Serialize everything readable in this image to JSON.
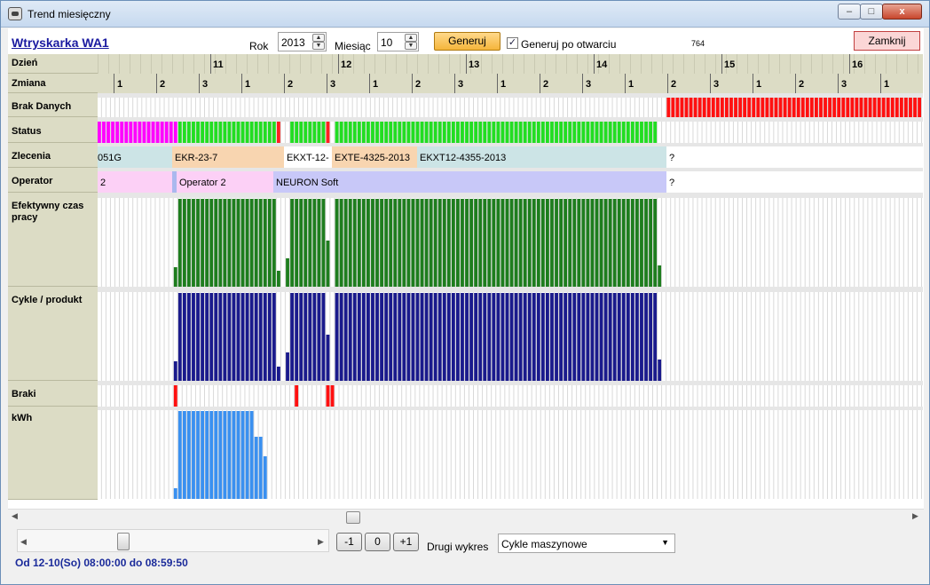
{
  "window": {
    "title": "Trend miesięczny",
    "min_label": "–",
    "max_label": "□",
    "close_label": "x"
  },
  "header": {
    "machine_title": "Wtryskarka WA1",
    "year_label": "Rok",
    "year_value": "2013",
    "month_label": "Miesiąc",
    "month_value": "10",
    "generate_label": "Generuj",
    "generate_on_open_label": "Generuj po otwarciu",
    "generate_on_open_checked": true,
    "code": "764",
    "close_label": "Zamknij"
  },
  "rows": {
    "day": "Dzień",
    "shift": "Zmiana",
    "no_data": "Brak Danych",
    "status": "Status",
    "orders": "Zlecenia",
    "operator": "Operator",
    "effective": "Efektywny czas pracy",
    "cycles": "Cykle / produkt",
    "rejects": "Braki",
    "kwh": "kWh"
  },
  "days": [
    "11",
    "12",
    "13",
    "14",
    "15",
    "16"
  ],
  "shifts": [
    "1",
    "2",
    "3",
    "1",
    "2",
    "3",
    "1",
    "2",
    "3",
    "1",
    "2",
    "3",
    "1",
    "2",
    "3",
    "1",
    "2",
    "3",
    "1"
  ],
  "orders_segments": [
    {
      "label": "051G",
      "color": "#cce4e6"
    },
    {
      "label": "EKR-23-7",
      "color": "#f8d5b0"
    },
    {
      "label": "EKXT-12-",
      "color": "#ffffff"
    },
    {
      "label": "EXTE-4325-2013",
      "color": "#f8d5b0"
    },
    {
      "label": "EKXT12-4355-2013",
      "color": "#cce4e6"
    },
    {
      "label": "?",
      "color": "#ffffff"
    }
  ],
  "operator_segments": [
    {
      "label": "2",
      "color": "#fcd0f6"
    },
    {
      "label": "Operator 2",
      "color": "#fcd0f6"
    },
    {
      "label": "NEURON Soft",
      "color": "#c8c8f8"
    },
    {
      "label": "?",
      "color": "#ffffff"
    }
  ],
  "colors": {
    "no_data": "#ff1010",
    "status_magenta": "#ff00ff",
    "status_green": "#22dd22",
    "status_red": "#ff2020",
    "effective": "#1e7d1e",
    "cycles": "#1a1a8c",
    "rejects": "#ff1010",
    "kwh": "#3a90f0"
  },
  "bottom": {
    "prev_label": "-1",
    "zero_label": "0",
    "next_label": "+1",
    "second_chart_label": "Drugi wykres",
    "second_chart_value": "Cykle maszynowe",
    "range_text": "Od 12-10(So) 08:00:00 do 08:59:50"
  }
}
